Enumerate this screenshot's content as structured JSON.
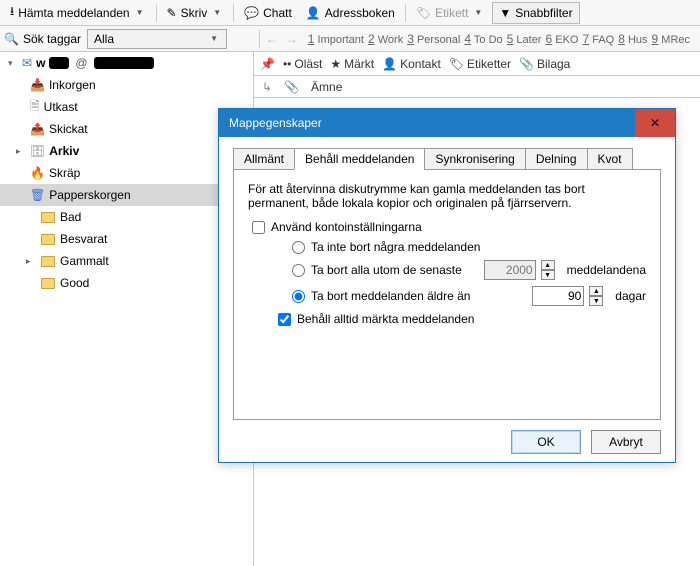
{
  "toolbar": {
    "get": "Hämta meddelanden",
    "write": "Skriv",
    "chat": "Chatt",
    "addressbook": "Adressboken",
    "tag": "Etikett",
    "quickfilter": "Snabbfilter"
  },
  "searchbar": {
    "label": "Sök taggar",
    "value": "Alla"
  },
  "quicktags": [
    "1 Important",
    "2 Work",
    "3 Personal",
    "4 To Do",
    "5 Later",
    "6 EKO",
    "7 FAQ",
    "8 Hus",
    "9 MRec"
  ],
  "folders": {
    "inkorgen": "Inkorgen",
    "utkast": "Utkast",
    "skickat": "Skickat",
    "arkiv": "Arkiv",
    "skrap": "Skräp",
    "papperskorgen": "Papperskorgen",
    "bad": "Bad",
    "besvarat": "Besvarat",
    "gammalt": "Gammalt",
    "good": "Good"
  },
  "filterbar": {
    "oläst": "Oläst",
    "märkt": "Märkt",
    "kontakt": "Kontakt",
    "etiketter": "Etiketter",
    "bilaga": "Bilaga"
  },
  "listheader": {
    "subject": "Ämne"
  },
  "dialog": {
    "title": "Mappegenskaper",
    "tabs": {
      "allmant": "Allmänt",
      "behall": "Behåll meddelanden",
      "synk": "Synkronisering",
      "delning": "Delning",
      "kvot": "Kvot"
    },
    "intro": "För att återvinna diskutrymme kan gamla meddelanden tas bort permanent, både lokala kopior och originalen på fjärrservern.",
    "useAccount": "Använd kontoinställningarna",
    "optNone": "Ta inte bort några meddelanden",
    "optAllBut": "Ta bort alla utom de senaste",
    "optAllButSuffix": "meddelandena",
    "optAllButValue": "2000",
    "optOlder": "Ta bort meddelanden äldre än",
    "optOlderSuffix": "dagar",
    "optOlderValue": "90",
    "keepStarred": "Behåll alltid märkta meddelanden",
    "ok": "OK",
    "cancel": "Avbryt"
  }
}
